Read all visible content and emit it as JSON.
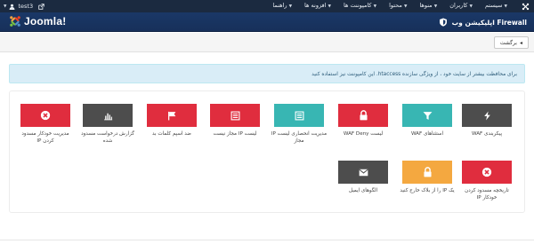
{
  "topbar": {
    "menu": [
      "سیستم",
      "کاربران",
      "منوها",
      "محتوا",
      "کامپوننت ها",
      "افزونه ها",
      "راهنما"
    ],
    "user": "test3"
  },
  "header": {
    "logo_text": "Joomla!",
    "page_title": "اپلیکیشن وب Firewall"
  },
  "toolbar": {
    "back_label": "برگشت"
  },
  "alert": {
    "text": "برای محافظت بیشتر از سایت خود ، از ویژگی سازنده htaccess. این کامپوننت نیز استفاده کنید"
  },
  "colors": {
    "red": "#e02d3e",
    "dark": "#4d4d4d",
    "teal": "#38b6b3",
    "orange": "#f4a840",
    "navy": "#1b2a40"
  },
  "tiles_row1": [
    {
      "label": "پیکربندی WAF",
      "icon": "bolt-icon",
      "color": "dark"
    },
    {
      "label": "استثناهای WAF",
      "icon": "filter-icon",
      "color": "teal"
    },
    {
      "label": "لیست WAF Deny",
      "icon": "lock-icon",
      "color": "red"
    },
    {
      "label": "مدیریت انحصاری لیست IP مجاز",
      "icon": "list-icon",
      "color": "teal"
    },
    {
      "label": "لیست IP مجاز نیست",
      "icon": "list-icon",
      "color": "red"
    },
    {
      "label": "ضد اسپم کلمات بد",
      "icon": "flag-icon",
      "color": "red"
    },
    {
      "label": "گزارش درخواست مسدود شده",
      "icon": "bar-chart-icon",
      "color": "dark"
    },
    {
      "label": "مدیریت خودکار مسدود کردن IP",
      "icon": "ban-icon",
      "color": "red"
    }
  ],
  "tiles_row2": [
    {
      "label": "تاریخچه مسدود کردن خودکار IP",
      "icon": "ban-icon",
      "color": "red"
    },
    {
      "label": "یک IP را از بلاک خارج کنید",
      "icon": "unlock-icon",
      "color": "orange"
    },
    {
      "label": "الگوهای ایمیل",
      "icon": "envelope-icon",
      "color": "dark"
    }
  ]
}
